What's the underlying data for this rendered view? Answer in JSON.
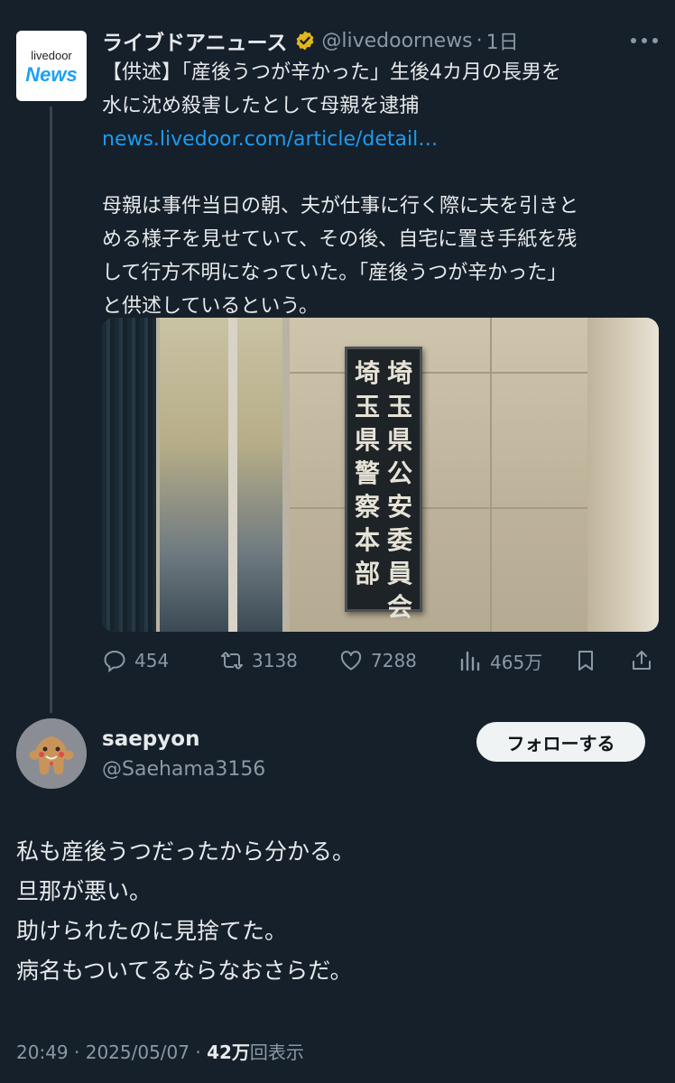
{
  "colors": {
    "background": "#15202b",
    "text": "#e7e9ea",
    "muted": "#8b98a5",
    "link": "#1d9bf0",
    "verified_badge": "#e2b719",
    "follow_button_bg": "#eff3f4"
  },
  "quoted_post": {
    "avatar_logo_small": "livedoor",
    "avatar_logo_big": "News",
    "author": "ライブドアニュース",
    "verified_icon": "verified-gold-badge-icon",
    "handle": "@livedoornews",
    "separator": "·",
    "time": "1日",
    "more_icon": "more-dots-icon",
    "lines": [
      "【供述】「産後うつが辛かった」生後4カ月の長男を",
      "水に沈め殺害したとして母親を逮捕"
    ],
    "link": "news.livedoor.com/article/detail…",
    "body_lines": [
      "母親は事件当日の朝、夫が仕事に行く際に夫を引きと",
      "める様子を見せていて、その後、自宅に置き手紙を残",
      "して行方不明になっていた。「産後うつが辛かった」",
      "と供述しているという。"
    ],
    "image": {
      "sign_column_right": [
        "埼",
        "玉",
        "県",
        "公",
        "安",
        "委",
        "員",
        "会"
      ],
      "sign_column_left": [
        "埼",
        "玉",
        "県",
        "警",
        "察",
        "本",
        "部"
      ]
    },
    "actions": {
      "replies": "454",
      "reposts": "3138",
      "likes": "7288",
      "views": "465万",
      "icons": [
        "reply-icon",
        "repost-icon",
        "like-icon",
        "views-icon",
        "bookmark-icon",
        "share-icon"
      ]
    }
  },
  "reply": {
    "name": "saepyon",
    "handle": "@Saehama3156",
    "follow_label": "フォローする",
    "lines": [
      "私も産後うつだったから分かる。",
      "旦那が悪い。",
      "助けられたのに見捨てた。",
      "病名もついてるならなおさらだ。"
    ],
    "meta": {
      "time": "20:49",
      "separator": "·",
      "date": "2025/05/07",
      "separator2": "·",
      "views_num": "42万",
      "views_label": "回表示"
    }
  }
}
